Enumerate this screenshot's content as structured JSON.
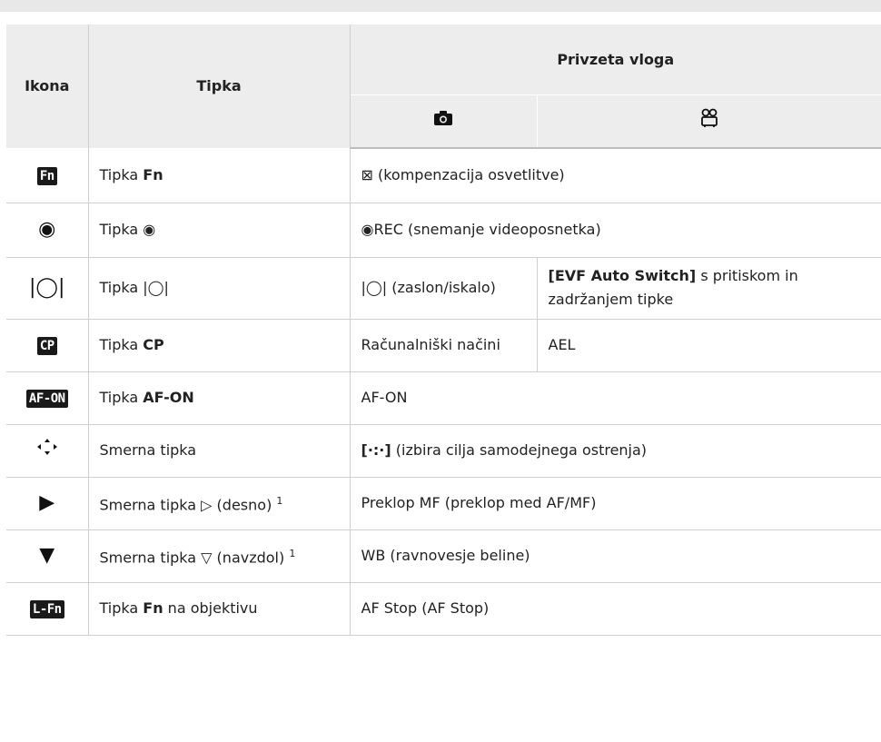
{
  "table": {
    "headers": {
      "ikona": "Ikona",
      "tipka": "Tipka",
      "privzeta": "Privzeta vloga",
      "camera_icon": "camera",
      "movie_icon": "movie-camera"
    },
    "rows": [
      {
        "icon_text": "Fn",
        "key_prefix": "Tipka ",
        "key_bold": "Fn",
        "key_suffix": "",
        "photo_role": "⊠ (kompenzacija osvetlitve)"
      },
      {
        "icon_text": "◉",
        "key_prefix": "Tipka ◉",
        "key_bold": "",
        "key_suffix": "",
        "photo_role": "◉REC (snemanje videoposnetka)"
      },
      {
        "icon_text": "|◯|",
        "key_prefix": "Tipka |◯|",
        "key_bold": "",
        "key_suffix": "",
        "photo_role": "|◯| (zaslon/iskalo)",
        "movie_role_bold": "[EVF Auto Switch]",
        "movie_role_rest": " s pritiskom in zadržanjem tipke"
      },
      {
        "icon_text": "CP",
        "key_prefix": "Tipka ",
        "key_bold": "CP",
        "key_suffix": "",
        "photo_role": "Računalniški načini",
        "movie_role": "AEL"
      },
      {
        "icon_text": "AF-ON",
        "key_prefix": "Tipka ",
        "key_bold": "AF-ON",
        "key_suffix": "",
        "photo_role": "AF-ON"
      },
      {
        "icon_text": "◂⁝▸",
        "key_prefix": "Smerna tipka",
        "key_bold": "",
        "key_suffix": "",
        "photo_role_bold": "[·:·]",
        "photo_role_rest": " (izbira cilja samodejnega ostrenja)"
      },
      {
        "icon_text": "▶",
        "key_prefix": "Smerna tipka ▷ (desno) ",
        "key_sup": "1",
        "photo_role": "Preklop MF (preklop med AF/MF)"
      },
      {
        "icon_text": "▼",
        "key_prefix": "Smerna tipka ▽ (navzdol) ",
        "key_sup": "1",
        "photo_role": "WB (ravnovesje beline)"
      },
      {
        "icon_text": "L-Fn",
        "key_prefix": "Tipka ",
        "key_bold": "Fn",
        "key_suffix": " na objektivu",
        "photo_role": "AF Stop (AF Stop)"
      }
    ]
  }
}
